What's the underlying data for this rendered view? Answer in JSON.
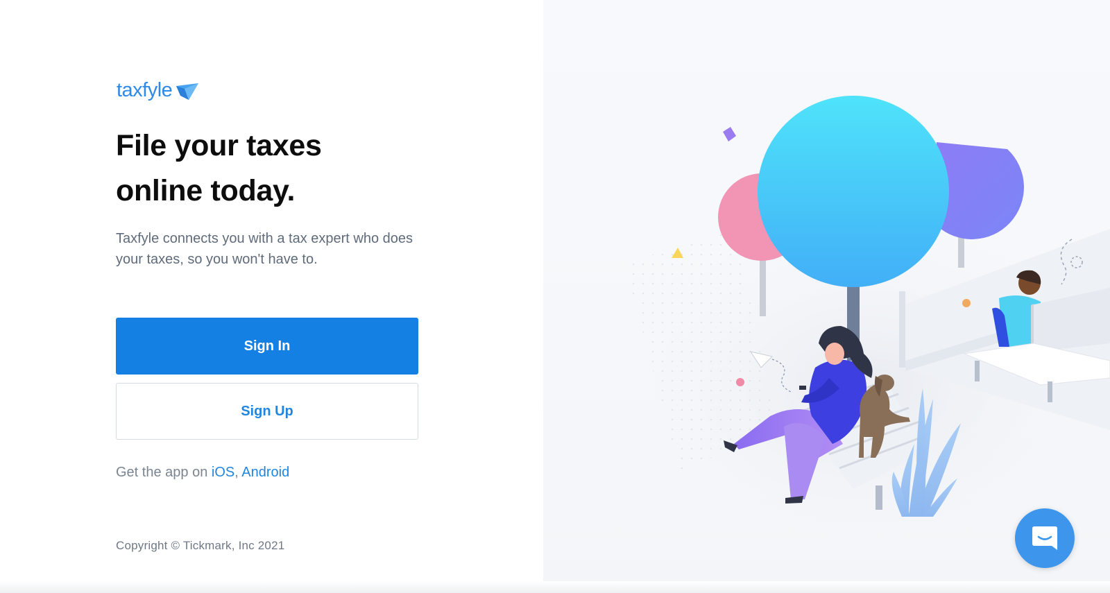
{
  "brand": {
    "name": "taxfyle",
    "accent": "#2e8ae6"
  },
  "hero": {
    "headline_line1": "File your taxes",
    "headline_line2": "online today.",
    "description": "Taxfyle connects you with a tax expert who does your taxes, so you won't have to."
  },
  "actions": {
    "sign_in_label": "Sign In",
    "sign_up_label": "Sign Up",
    "primary_color": "#1580e3"
  },
  "app_links": {
    "prefix": "Get the app on ",
    "ios_label": "iOS",
    "separator": ", ",
    "android_label": "Android"
  },
  "footer": {
    "copyright": "Copyright © Tickmark, Inc 2021"
  },
  "chat": {
    "icon": "chat-bubble-icon",
    "color": "#3d96ec"
  }
}
